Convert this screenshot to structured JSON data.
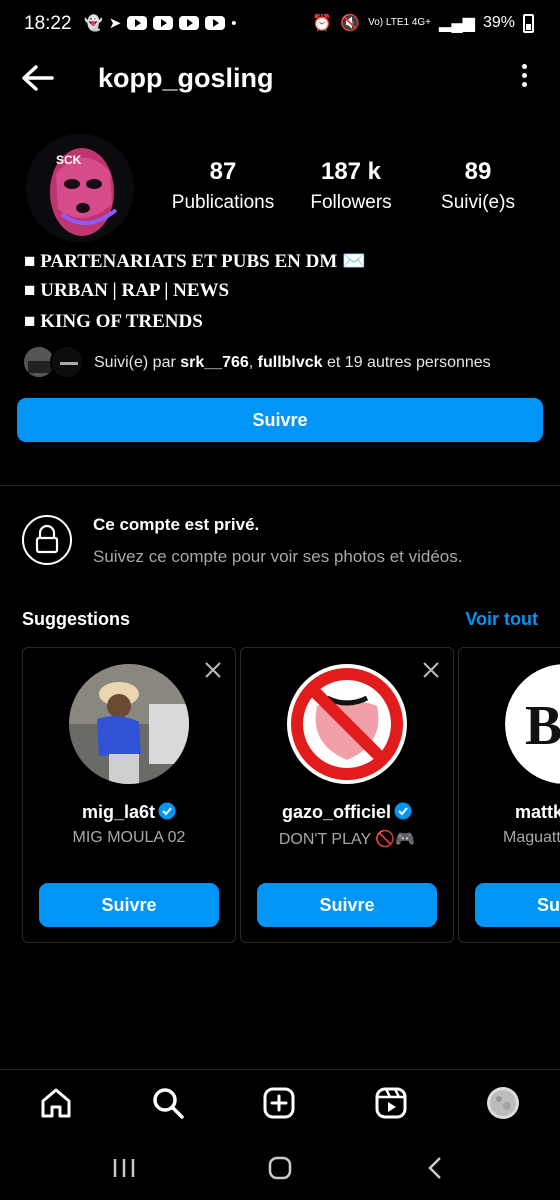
{
  "status_bar": {
    "time": "18:22",
    "network": "Vo) LTE1 4G+",
    "battery": "39%"
  },
  "header": {
    "username": "kopp_gosling"
  },
  "profile": {
    "avatar_text": "SCK",
    "stats": [
      {
        "value": "87",
        "label": "Publications"
      },
      {
        "value": "187 k",
        "label": "Followers"
      },
      {
        "value": "89",
        "label": "Suivi(e)s"
      }
    ],
    "bio_lines": [
      "■ PARTENARIATS ET PUBS EN DM ✉️",
      "■ URBAN | RAP | NEWS",
      "■ KING OF TRENDS"
    ],
    "followed_by": {
      "prefix": "Suivi(e) par ",
      "user1": "srk__766",
      "sep": ", ",
      "user2": "fullblvck",
      "suffix": " et 19 autres personnes"
    },
    "follow_button": "Suivre"
  },
  "private": {
    "title": "Ce compte est privé.",
    "subtitle": "Suivez ce compte pour voir ses photos et vidéos."
  },
  "suggestions": {
    "title": "Suggestions",
    "see_all": "Voir tout",
    "cards": [
      {
        "name": "mig_la6t",
        "subtitle": "MIG MOULA 02",
        "button": "Suivre"
      },
      {
        "name": "gazo_officiel",
        "subtitle": "DON'T PLAY 🚫🎮",
        "button": "Suivre"
      },
      {
        "name": "mattk",
        "subtitle": "Maguatt",
        "button": "Su"
      }
    ]
  },
  "colors": {
    "accent": "#0095f6",
    "background": "#000000",
    "muted_text": "#a8a8a8"
  }
}
